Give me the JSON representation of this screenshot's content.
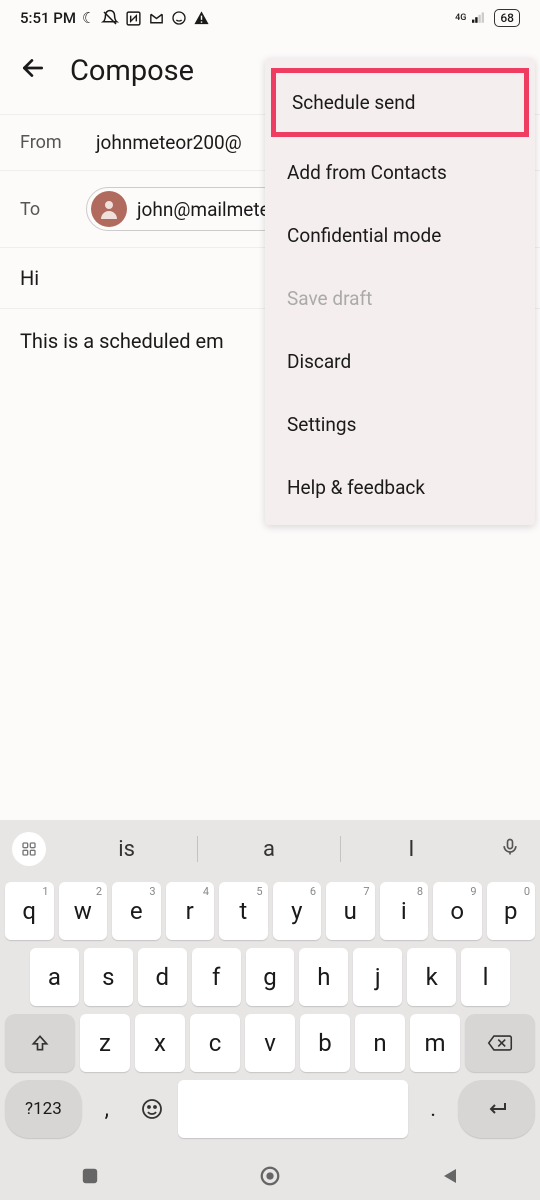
{
  "status": {
    "time": "5:51 PM",
    "network_label": "4G",
    "battery": "68"
  },
  "header": {
    "title": "Compose"
  },
  "fields": {
    "from_label": "From",
    "from_value": "johnmeteor200@",
    "to_label": "To",
    "to_value": "john@mailmete"
  },
  "subject": "Hi",
  "body_text": "This is a scheduled em",
  "menu": {
    "items": [
      {
        "label": "Schedule send",
        "highlighted": true,
        "disabled": false
      },
      {
        "label": "Add from Contacts",
        "highlighted": false,
        "disabled": false
      },
      {
        "label": "Confidential mode",
        "highlighted": false,
        "disabled": false
      },
      {
        "label": "Save draft",
        "highlighted": false,
        "disabled": true
      },
      {
        "label": "Discard",
        "highlighted": false,
        "disabled": false
      },
      {
        "label": "Settings",
        "highlighted": false,
        "disabled": false
      },
      {
        "label": "Help & feedback",
        "highlighted": false,
        "disabled": false
      }
    ]
  },
  "keyboard": {
    "suggestions": [
      "is",
      "a",
      "I"
    ],
    "row1": [
      "q",
      "w",
      "e",
      "r",
      "t",
      "y",
      "u",
      "i",
      "o",
      "p"
    ],
    "row1_sup": [
      "1",
      "2",
      "3",
      "4",
      "5",
      "6",
      "7",
      "8",
      "9",
      "0"
    ],
    "row2": [
      "a",
      "s",
      "d",
      "f",
      "g",
      "h",
      "j",
      "k",
      "l"
    ],
    "row3": [
      "z",
      "x",
      "c",
      "v",
      "b",
      "n",
      "m"
    ],
    "sym_label": "?123",
    "comma": ",",
    "period": "."
  }
}
